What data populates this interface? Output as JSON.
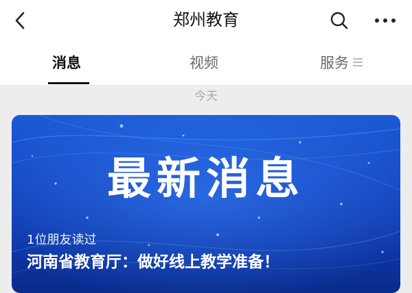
{
  "header": {
    "title": "郑州教育",
    "icons": {
      "back": "chevron-left-icon",
      "search": "search-icon",
      "more": "more-horizontal-icon"
    }
  },
  "tabs": [
    {
      "label": "消息",
      "active": true
    },
    {
      "label": "视频",
      "active": false
    },
    {
      "label": "服务",
      "active": false,
      "icon": "menu-lines-icon"
    }
  ],
  "feed": {
    "date_label": "今天",
    "card": {
      "headline": "最新消息",
      "readers": "1位朋友读过",
      "title": "河南省教育厅：做好线上教学准备！",
      "colors": {
        "bg_top": "#1a5bd6",
        "bg_bottom": "#0a2b8c"
      }
    }
  }
}
